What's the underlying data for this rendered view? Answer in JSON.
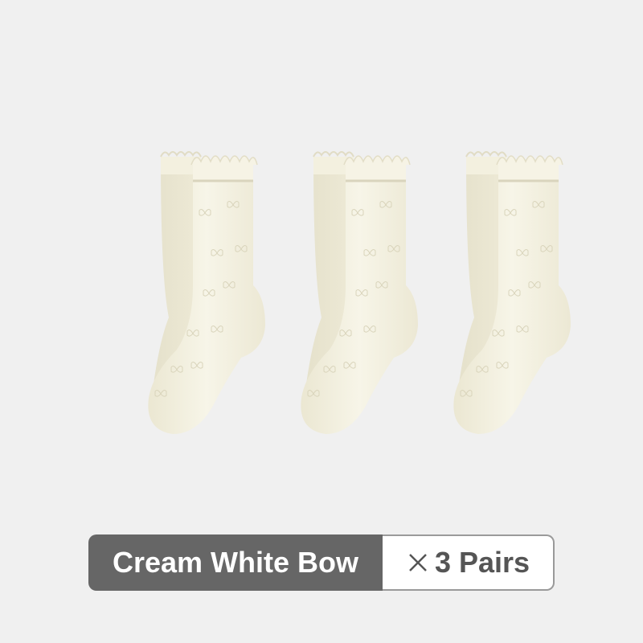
{
  "product": {
    "variant_label": "Cream White Bow",
    "quantity_label": "3 Pairs",
    "multiply_icon": "multiply-icon",
    "item_count": 3
  },
  "colors": {
    "background": "#f0f0f0",
    "sock": "#f4f1e2",
    "sock_shadow": "#e4e0cb",
    "label_dark": "#666666",
    "label_text": "#ffffff",
    "quantity_text": "#555555"
  }
}
